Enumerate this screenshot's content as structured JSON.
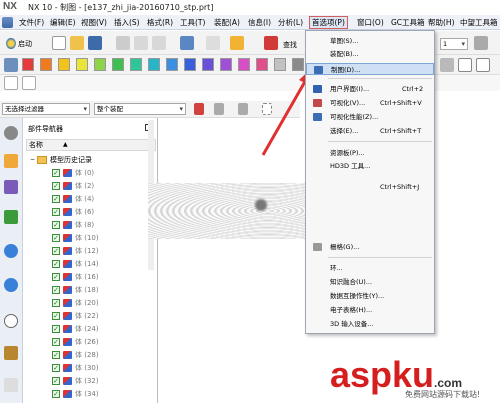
{
  "window": {
    "logo": "NX",
    "title": "NX 10 - 制图 - [e137_zhi_jia-20160710_stp.prt]"
  },
  "menubar": {
    "items": [
      {
        "label": "文件(F)"
      },
      {
        "label": "编辑(E)"
      },
      {
        "label": "视图(V)"
      },
      {
        "label": "插入(S)"
      },
      {
        "label": "格式(R)"
      },
      {
        "label": "工具(T)"
      },
      {
        "label": "装配(A)"
      },
      {
        "label": "信息(I)"
      },
      {
        "label": "分析(L)"
      },
      {
        "label": "首选项(P)"
      },
      {
        "label": "窗口(O)"
      },
      {
        "label": "GC工具箱"
      },
      {
        "label": "帮助(H)"
      },
      {
        "label": "中望工具箱"
      }
    ]
  },
  "toolbar": {
    "start_label": "启动",
    "search_label": "查找",
    "zoom_value": "1"
  },
  "filters": {
    "selection_filter": "无选择过滤器",
    "scope": "整个装配"
  },
  "colors": {
    "swatches": [
      "#e63b3b",
      "#f07a1e",
      "#f4c21c",
      "#e9e53a",
      "#8fd34a",
      "#3fbf4f",
      "#2ec79a",
      "#27b5c9",
      "#3a8fe0",
      "#3a5fdc",
      "#6a4fd8",
      "#a24fd8",
      "#d64fc4",
      "#e04f8a",
      "#c2c2c2",
      "#8a8a8a"
    ]
  },
  "navigator": {
    "title": "部件导航器",
    "column_name": "名称",
    "sort_indicator": "▲",
    "root_label": "模型历史记录",
    "rows": [
      {
        "label": "体 (0)"
      },
      {
        "label": "体 (2)"
      },
      {
        "label": "体 (4)"
      },
      {
        "label": "体 (6)"
      },
      {
        "label": "体 (8)"
      },
      {
        "label": "体 (10)"
      },
      {
        "label": "体 (12)"
      },
      {
        "label": "体 (14)"
      },
      {
        "label": "体 (16)"
      },
      {
        "label": "体 (18)"
      },
      {
        "label": "体 (20)"
      },
      {
        "label": "体 (22)"
      },
      {
        "label": "体 (24)"
      },
      {
        "label": "体 (26)"
      },
      {
        "label": "体 (28)"
      },
      {
        "label": "体 (30)"
      },
      {
        "label": "体 (32)"
      },
      {
        "label": "体 (34)"
      }
    ]
  },
  "preferences_menu": {
    "items": [
      {
        "label": "草图(S)...",
        "shortcut": ""
      },
      {
        "label": "装配(B)...",
        "shortcut": ""
      },
      {
        "label": "制图(D)...",
        "shortcut": ""
      },
      {
        "label": "用户界面(I)...",
        "shortcut": "Ctrl+2"
      },
      {
        "label": "可视化(V)...",
        "shortcut": "Ctrl+Shift+V"
      },
      {
        "label": "可视化性能(Z)...",
        "shortcut": ""
      },
      {
        "label": "选择(E)...",
        "shortcut": "Ctrl+Shift+T"
      },
      {
        "label": "资源板(P)...",
        "shortcut": ""
      },
      {
        "label": "HD3D 工具...",
        "shortcut": ""
      },
      {
        "label": "",
        "shortcut": "Ctrl+Shift+J"
      },
      {
        "label": "栅格(G)...",
        "shortcut": ""
      },
      {
        "label": "环...",
        "shortcut": ""
      },
      {
        "label": "知识融合(U)...",
        "shortcut": ""
      },
      {
        "label": "数据互操作性(Y)...",
        "shortcut": ""
      },
      {
        "label": "电子表格(H)...",
        "shortcut": ""
      },
      {
        "label": "3D 输入设备...",
        "shortcut": ""
      }
    ]
  },
  "watermark": {
    "brand": "aspku",
    "suffix": ".com",
    "tagline": "免费网站源码下载站!"
  }
}
